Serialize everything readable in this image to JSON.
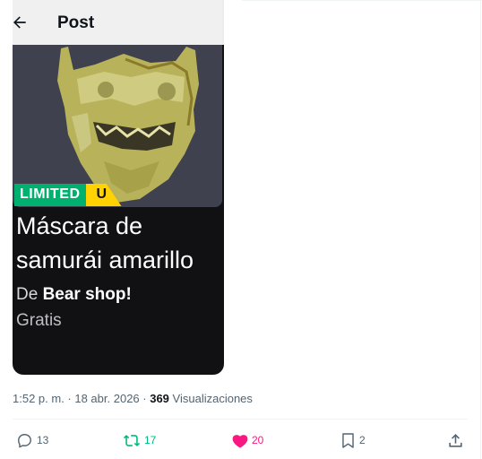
{
  "header": {
    "back_icon": "arrow-left-icon",
    "title": "Post"
  },
  "item": {
    "badge_limited": "LIMITED",
    "badge_u": "U",
    "title": "Máscara de samurái amarillo",
    "creator_prefix": "De",
    "creator_name": "Bear shop!",
    "price": "Gratis",
    "image_icon": "samurai-mask-icon"
  },
  "meta": {
    "timestamp": "1:52 p. m. · 18 abr. 2026 ·",
    "views_count": "369",
    "views_label": "Visualizaciones"
  },
  "actions": {
    "replies": "13",
    "reposts": "17",
    "likes": "20",
    "bookmarks": "2"
  },
  "colors": {
    "limited_green": "#00b06f",
    "u_yellow": "#ffd200",
    "repost_green": "#00ba7c",
    "like_pink": "#f91880",
    "card_bg": "#111114",
    "thumb_bg": "#3f414e"
  }
}
